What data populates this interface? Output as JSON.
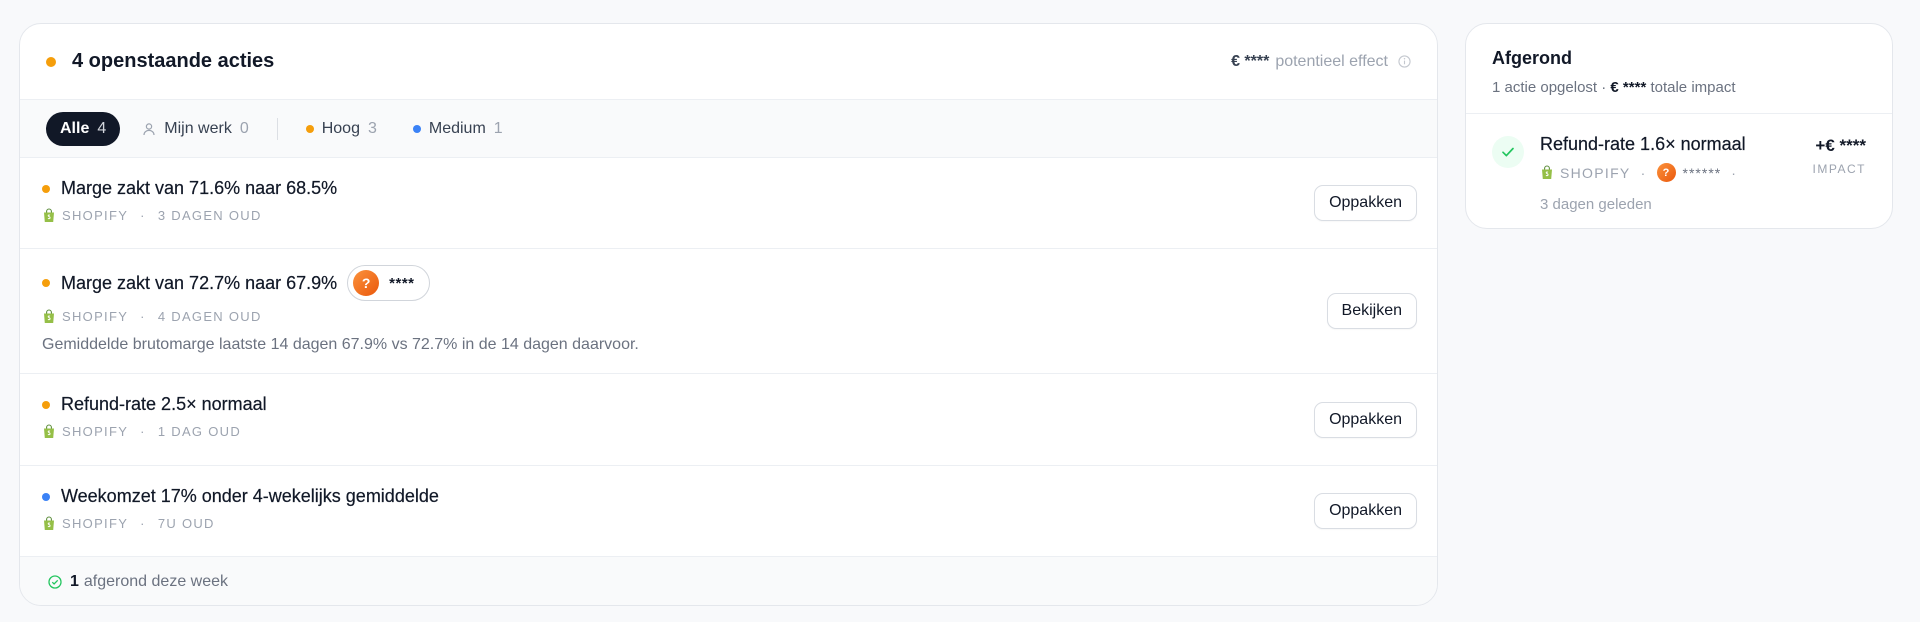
{
  "actions_panel": {
    "title": "4 openstaande acties",
    "effect_amount": "€ ****",
    "effect_label": "potentieel effect",
    "filters": [
      {
        "label": "Alle",
        "count": "4"
      },
      {
        "label": "Mijn werk",
        "count": "0"
      },
      {
        "label": "Hoog",
        "count": "3"
      },
      {
        "label": "Medium",
        "count": "1"
      }
    ],
    "rows": [
      {
        "title": "Marge zakt van 71.6% naar 68.5%",
        "source": "SHOPIFY",
        "age": "3 DAGEN OUD",
        "button": "Oppakken",
        "priority": "hoog"
      },
      {
        "title": "Marge zakt van 72.7% naar 67.9%",
        "assignee_initial": "?",
        "assignee_name": "****",
        "source": "SHOPIFY",
        "age": "4 DAGEN OUD",
        "description": "Gemiddelde brutomarge laatste 14 dagen 67.9% vs 72.7% in de 14 dagen daarvoor.",
        "button": "Bekijken",
        "priority": "hoog"
      },
      {
        "title": "Refund-rate 2.5× normaal",
        "source": "SHOPIFY",
        "age": "1 DAG OUD",
        "button": "Oppakken",
        "priority": "hoog"
      },
      {
        "title": "Weekomzet 17% onder 4-wekelijks gemiddelde",
        "source": "SHOPIFY",
        "age": "7U OUD",
        "button": "Oppakken",
        "priority": "medium"
      }
    ],
    "footer": {
      "count": "1",
      "label": "afgerond deze week"
    }
  },
  "completed_panel": {
    "title": "Afgerond",
    "subtitle_prefix": "1 actie opgelost ·",
    "subtitle_amount": "€ ****",
    "subtitle_suffix": "totale impact",
    "item": {
      "title": "Refund-rate 1.6× normaal",
      "source": "SHOPIFY",
      "assignee_initial": "?",
      "assignee_name": "******",
      "time": "3 dagen geleden",
      "impact_value": "+€ ****",
      "impact_label": "IMPACT"
    }
  },
  "colors": {
    "priority_high": "#f59e0b",
    "priority_medium": "#3b82f6",
    "shopify_green": "#95bf47",
    "success_green": "#22c55e"
  }
}
